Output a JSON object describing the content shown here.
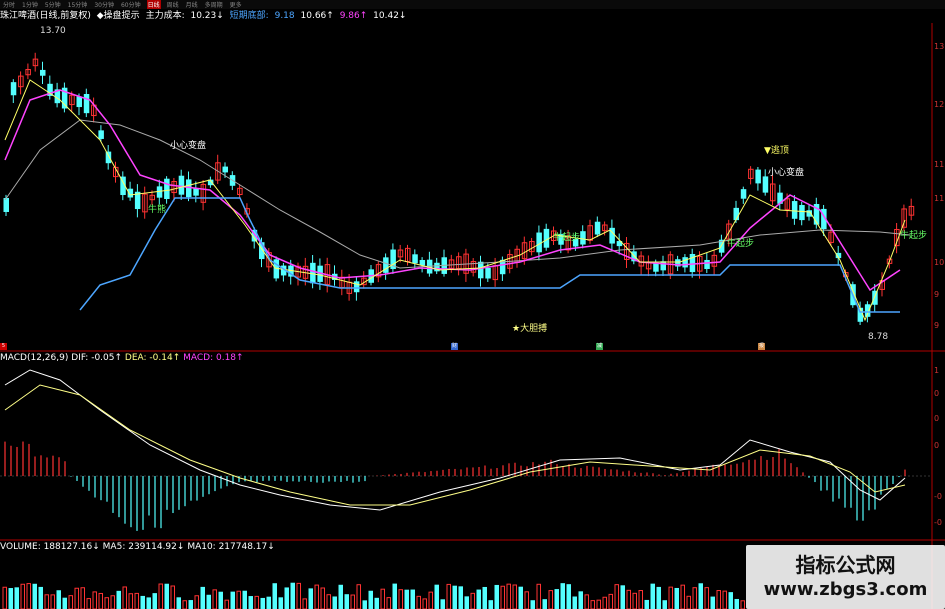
{
  "period_tabs": [
    "分时",
    "1分钟",
    "5分钟",
    "15分钟",
    "30分钟",
    "60分钟",
    "日线",
    "周线",
    "月线",
    "多周期",
    "更多"
  ],
  "active_tab": "日线",
  "header": {
    "stock": "珠江啤酒(日线,前复权)",
    "indicator": "◆操盘提示",
    "cost_label": "主力成本:",
    "cost_value": "10.23↓",
    "bottom_label": "短期底部:",
    "bottom_value": "9.18",
    "v1": "10.66↑",
    "v2": "9.86↑",
    "v3": "10.42↓"
  },
  "annotations": {
    "high": "13.70",
    "careful1": "小心变盘",
    "careful2": "小心变盘",
    "escape": "▼逃顶",
    "bull1": "牛熊",
    "bull2": "牛起步",
    "bull3": "牛起步",
    "bull4": "牛起步",
    "bigbet": "★大胆搏",
    "low": "8.78"
  },
  "markers": [
    "5",
    "财",
    "减",
    "报"
  ],
  "macd": {
    "label": "MACD(12,26,9)",
    "dif": "DIF: -0.05↑",
    "dea": "DEA: -0.14↑",
    "macd": "MACD: 0.18↑"
  },
  "volume": {
    "label": "VOLUME: 188127.16↓",
    "ma5": "MA5: 239114.92↓",
    "ma10": "MA10: 217748.17↓"
  },
  "right_axis_price": [
    "13",
    "12",
    "11",
    "11",
    "10",
    "9",
    "9"
  ],
  "right_axis_macd": [
    "1",
    "0",
    "0",
    "0",
    "-0",
    "-0"
  ],
  "watermark": {
    "line1": "指标公式网",
    "line2": "www.zbgs3.com"
  },
  "colors": {
    "up": "#ff3333",
    "down": "#54ffff",
    "ma5": "#ffff66",
    "ma10": "#ff44ff",
    "ma30": "#aaaaaa",
    "cost": "#4da6ff",
    "dif": "#ffffff",
    "dea": "#ffff88"
  }
}
